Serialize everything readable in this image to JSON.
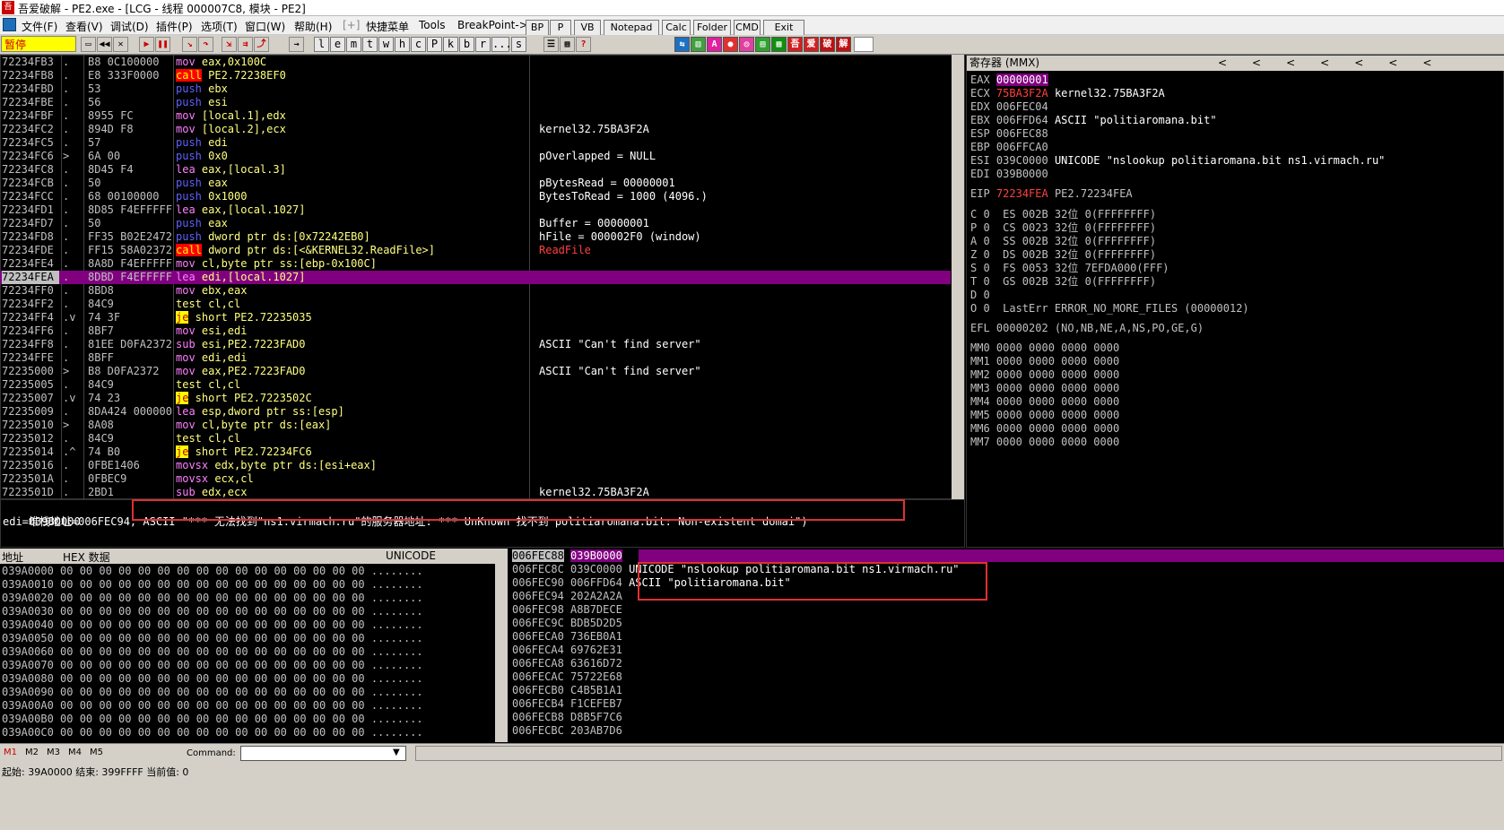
{
  "window": {
    "title": "吾爱破解 - PE2.exe - [LCG - 线程 000007C8, 模块 - PE2]"
  },
  "menu": [
    "文件(F)",
    "查看(V)",
    "调试(D)",
    "插件(P)",
    "选项(T)",
    "窗口(W)",
    "帮助(H)",
    "[+]",
    "快捷菜单",
    "Tools",
    "BreakPoint->"
  ],
  "plugin_buttons": [
    "BP",
    "P",
    "VB",
    "Notepad",
    "Calc",
    "Folder",
    "CMD",
    "Exit"
  ],
  "toolbar": {
    "status": "暂停",
    "letters": [
      "l",
      "e",
      "m",
      "t",
      "w",
      "h",
      "c",
      "P",
      "k",
      "b",
      "r",
      "...",
      "s"
    ]
  },
  "cpu_rows": [
    {
      "addr": "72234FB3",
      "mark": ".",
      "hex": "B8 0C100000",
      "dis": "mov eax,0x100C",
      "com": ""
    },
    {
      "addr": "72234FB8",
      "mark": ".",
      "hex": "E8 333F0000",
      "dis": "call PE2.72238EF0",
      "com": ""
    },
    {
      "addr": "72234FBD",
      "mark": ".",
      "hex": "53",
      "dis": "push ebx",
      "com": ""
    },
    {
      "addr": "72234FBE",
      "mark": ".",
      "hex": "56",
      "dis": "push esi",
      "com": ""
    },
    {
      "addr": "72234FBF",
      "mark": ".",
      "hex": "8955 FC",
      "dis": "mov [local.1],edx",
      "com": ""
    },
    {
      "addr": "72234FC2",
      "mark": ".",
      "hex": "894D F8",
      "dis": "mov [local.2],ecx",
      "com": "kernel32.75BA3F2A"
    },
    {
      "addr": "72234FC5",
      "mark": ".",
      "hex": "57",
      "dis": "push edi",
      "com": ""
    },
    {
      "addr": "72234FC6",
      "mark": ">",
      "hex": "6A 00",
      "dis": "push 0x0",
      "com": "pOverlapped = NULL"
    },
    {
      "addr": "72234FC8",
      "mark": ".",
      "hex": "8D45 F4",
      "dis": "lea eax,[local.3]",
      "com": ""
    },
    {
      "addr": "72234FCB",
      "mark": ".",
      "hex": "50",
      "dis": "push eax",
      "com": "pBytesRead = 00000001"
    },
    {
      "addr": "72234FCC",
      "mark": ".",
      "hex": "68 00100000",
      "dis": "push 0x1000",
      "com": "BytesToRead = 1000 (4096.)"
    },
    {
      "addr": "72234FD1",
      "mark": ".",
      "hex": "8D85 F4EFFFFF",
      "dis": "lea eax,[local.1027]",
      "com": ""
    },
    {
      "addr": "72234FD7",
      "mark": ".",
      "hex": "50",
      "dis": "push eax",
      "com": "Buffer = 00000001"
    },
    {
      "addr": "72234FD8",
      "mark": ".",
      "hex": "FF35 B02E2472",
      "dis": "push dword ptr ds:[0x72242EB0]",
      "com": "hFile = 000002F0 (window)"
    },
    {
      "addr": "72234FDE",
      "mark": ".",
      "hex": "FF15 58A02372",
      "dis": "call dword ptr ds:[<&KERNEL32.ReadFile>]",
      "com": "ReadFile"
    },
    {
      "addr": "72234FE4",
      "mark": ".",
      "hex": "8A8D F4EFFFFF",
      "dis": "mov cl,byte ptr ss:[ebp-0x100C]",
      "com": ""
    },
    {
      "addr": "72234FEA",
      "mark": ".",
      "hex": "8DBD F4EFFFFF",
      "dis": "lea edi,[local.1027]",
      "com": ""
    },
    {
      "addr": "72234FF0",
      "mark": ".",
      "hex": "8BD8",
      "dis": "mov ebx,eax",
      "com": ""
    },
    {
      "addr": "72234FF2",
      "mark": ".",
      "hex": "84C9",
      "dis": "test cl,cl",
      "com": ""
    },
    {
      "addr": "72234FF4",
      "mark": ".v",
      "hex": "74 3F",
      "dis": "je short PE2.72235035",
      "com": ""
    },
    {
      "addr": "72234FF6",
      "mark": ".",
      "hex": "8BF7",
      "dis": "mov esi,edi",
      "com": ""
    },
    {
      "addr": "72234FF8",
      "mark": ".",
      "hex": "81EE D0FA2372",
      "dis": "sub esi,PE2.7223FAD0",
      "com": "ASCII \"Can't find server\""
    },
    {
      "addr": "72234FFE",
      "mark": ".",
      "hex": "8BFF",
      "dis": "mov edi,edi",
      "com": ""
    },
    {
      "addr": "72235000",
      "mark": ">",
      "hex": "B8 D0FA2372",
      "dis": "mov eax,PE2.7223FAD0",
      "com": "ASCII \"Can't find server\""
    },
    {
      "addr": "72235005",
      "mark": ".",
      "hex": "84C9",
      "dis": "test cl,cl",
      "com": ""
    },
    {
      "addr": "72235007",
      "mark": ".v",
      "hex": "74 23",
      "dis": "je short PE2.7223502C",
      "com": ""
    },
    {
      "addr": "72235009",
      "mark": ".",
      "hex": "8DA424 00000000",
      "dis": "lea esp,dword ptr ss:[esp]",
      "com": ""
    },
    {
      "addr": "72235010",
      "mark": ">",
      "hex": "8A08",
      "dis": "mov cl,byte ptr ds:[eax]",
      "com": ""
    },
    {
      "addr": "72235012",
      "mark": ".",
      "hex": "84C9",
      "dis": "test cl,cl",
      "com": ""
    },
    {
      "addr": "72235014",
      "mark": ".^",
      "hex": "74 B0",
      "dis": "je short PE2.72234FC6",
      "com": ""
    },
    {
      "addr": "72235016",
      "mark": ".",
      "hex": "0FBE1406",
      "dis": "movsx edx,byte ptr ds:[esi+eax]",
      "com": ""
    },
    {
      "addr": "7223501A",
      "mark": ".",
      "hex": "0FBEC9",
      "dis": "movsx ecx,cl",
      "com": ""
    },
    {
      "addr": "7223501D",
      "mark": ".",
      "hex": "2BD1",
      "dis": "sub edx,ecx",
      "com": "kernel32.75BA3F2A"
    }
  ],
  "info": {
    "line1_prefix": "堆栈地址=006FEC94, ",
    "line1_ascii": "ASCII \"*** 无法找到\"ns1.virmach.ru\"的服务器地址: *** UnKnown 找不到 politiaromana.bit: Non-existent domai\")",
    "line2": "edi=039B0000"
  },
  "registers": {
    "header": "寄存器 (MMX)",
    "gp": [
      {
        "name": "EAX",
        "val": "00000001",
        "note": ""
      },
      {
        "name": "ECX",
        "val": "75BA3F2A",
        "note": "kernel32.75BA3F2A"
      },
      {
        "name": "EDX",
        "val": "006FEC04",
        "note": ""
      },
      {
        "name": "EBX",
        "val": "006FFD64",
        "note": "ASCII \"politiaromana.bit\""
      },
      {
        "name": "ESP",
        "val": "006FEC88",
        "note": ""
      },
      {
        "name": "EBP",
        "val": "006FFCA0",
        "note": ""
      },
      {
        "name": "ESI",
        "val": "039C0000",
        "note": "UNICODE \"nslookup politiaromana.bit ns1.virmach.ru\""
      },
      {
        "name": "EDI",
        "val": "039B0000",
        "note": ""
      }
    ],
    "eip": {
      "name": "EIP",
      "val": "72234FEA",
      "note": "PE2.72234FEA"
    },
    "flags": [
      "C 0  ES 002B 32位 0(FFFFFFFF)",
      "P 0  CS 0023 32位 0(FFFFFFFF)",
      "A 0  SS 002B 32位 0(FFFFFFFF)",
      "Z 0  DS 002B 32位 0(FFFFFFFF)",
      "S 0  FS 0053 32位 7EFDA000(FFF)",
      "T 0  GS 002B 32位 0(FFFFFFFF)",
      "D 0",
      "O 0  LastErr ERROR_NO_MORE_FILES (00000012)"
    ],
    "efl": "EFL 00000202 (NO,NB,NE,A,NS,PO,GE,G)",
    "mmx": [
      "MM0 0000 0000 0000 0000",
      "MM1 0000 0000 0000 0000",
      "MM2 0000 0000 0000 0000",
      "MM3 0000 0000 0000 0000",
      "MM4 0000 0000 0000 0000",
      "MM5 0000 0000 0000 0000",
      "MM6 0000 0000 0000 0000",
      "MM7 0000 0000 0000 0000"
    ]
  },
  "dump": {
    "headers": [
      "地址",
      "HEX 数据",
      "UNICODE"
    ],
    "hex": "00 00 00 00 00 00 00 00 00 00 00 00 00 00 00 00",
    "uni": "........",
    "addrs": [
      "039A0000",
      "039A0010",
      "039A0020",
      "039A0030",
      "039A0040",
      "039A0050",
      "039A0060",
      "039A0070",
      "039A0080",
      "039A0090",
      "039A00A0",
      "039A00B0",
      "039A00C0"
    ]
  },
  "stack": [
    {
      "addr": "006FEC88",
      "val": "039B0000",
      "note": ""
    },
    {
      "addr": "006FEC8C",
      "val": "039C0000",
      "note": "UNICODE \"nslookup politiaromana.bit ns1.virmach.ru\""
    },
    {
      "addr": "006FEC90",
      "val": "006FFD64",
      "note": "ASCII \"politiaromana.bit\""
    },
    {
      "addr": "006FEC94",
      "val": "202A2A2A",
      "note": ""
    },
    {
      "addr": "006FEC98",
      "val": "A8B7DECE",
      "note": ""
    },
    {
      "addr": "006FEC9C",
      "val": "BDB5D2D5",
      "note": ""
    },
    {
      "addr": "006FECA0",
      "val": "736EB0A1",
      "note": ""
    },
    {
      "addr": "006FECA4",
      "val": "69762E31",
      "note": ""
    },
    {
      "addr": "006FECA8",
      "val": "63616D72",
      "note": ""
    },
    {
      "addr": "006FECAC",
      "val": "75722E68",
      "note": ""
    },
    {
      "addr": "006FECB0",
      "val": "C4B5B1A1",
      "note": ""
    },
    {
      "addr": "006FECB4",
      "val": "F1CEFEB7",
      "note": ""
    },
    {
      "addr": "006FECB8",
      "val": "D8B5F7C6",
      "note": ""
    },
    {
      "addr": "006FECBC",
      "val": "203AB7D6",
      "note": ""
    }
  ],
  "cmdbar": {
    "tabs": [
      "M1",
      "M2",
      "M3",
      "M4",
      "M5"
    ],
    "label": "Command:",
    "value": ""
  },
  "statusbar": {
    "text": "起始: 39A0000 结束: 399FFFF 当前值: 0"
  }
}
